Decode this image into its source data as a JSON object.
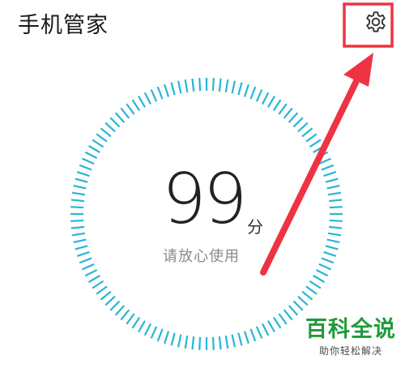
{
  "header": {
    "title": "手机管家",
    "settings_icon": "gear-icon"
  },
  "health": {
    "score": "99",
    "unit": "分",
    "status": "请放心使用"
  },
  "colors": {
    "accent": "#29b5d6",
    "annotation": "#ee3344"
  },
  "watermark": {
    "title": "百科全说",
    "subtitle": "助你轻松解决"
  }
}
